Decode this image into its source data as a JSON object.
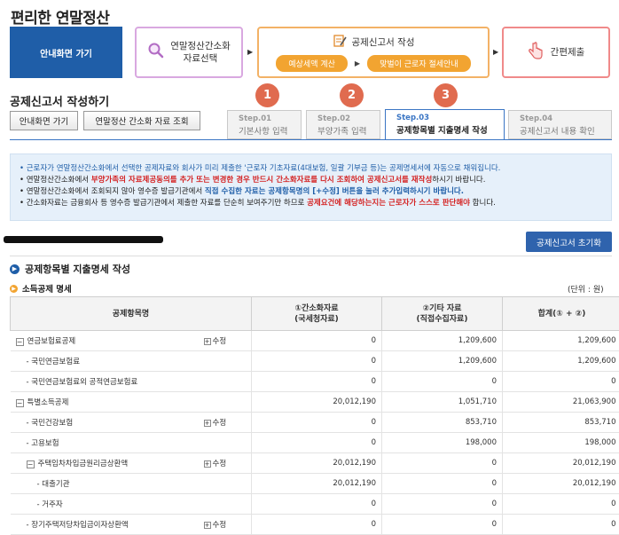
{
  "app_title": "편리한 연말정산",
  "guide_box_label": "안내화면 가기",
  "flow": {
    "step1": [
      "연말정산간소화",
      "자료선택"
    ],
    "step2": {
      "title": "공제신고서 작성",
      "pill1": "예상세액 계산",
      "pill2": "맞벌이 근로자 절세안내"
    },
    "step3": "간편제출"
  },
  "section_title": "공제신고서 작성하기",
  "buttons": {
    "guide": "안내화면 가기",
    "lookup": "연말정산 간소화 자료 조회",
    "reset": "공제신고서 초기화"
  },
  "steps": [
    {
      "badge": "1",
      "num": "Step.01",
      "label": "기본사항 입력"
    },
    {
      "badge": "2",
      "num": "Step.02",
      "label": "부양가족 입력"
    },
    {
      "badge": "3",
      "num": "Step.03",
      "label": "공제항목별 지출명세 작성"
    },
    {
      "num": "Step.04",
      "label": "공제신고서 내용 확인"
    }
  ],
  "notices": {
    "n1": "근로자가 연말정산간소화에서 선택한 공제자료와 회사가 미리 제출한 '근로자 기초자료(4대보험, 일괄 기부금 등)는 공제명세서에 자동으로 채워집니다.",
    "n2_a": "연말정산간소화에서 ",
    "n2_b": "부양가족의 자료제공동의를 추가 또는 변경한 경우 반드시 간소화자료를 다시 조회하여 공제신고서를 재작성",
    "n2_c": "하시기 바랍니다.",
    "n3_a": "연말정산간소화에서 조회되지 않아 영수증 발급기관에서 ",
    "n3_b": "직접 수집한 자료는 공제항목명의 [+수정] 버튼을 눌러 추가입력하시기 바랍니다.",
    "n4_a": "간소화자료는 금융회사 등 영수증 발급기관에서 제출한 자료를 단순히 보여주기만 하므로 ",
    "n4_b": "공제요건에 해당하는지는 근로자가 스스로 판단해야",
    "n4_c": " 합니다."
  },
  "sub_title": "공제항목별 지출명세 작성",
  "sub_sub_title": "소득공제 명세",
  "unit": "(단위 : 원)",
  "table": {
    "headers": {
      "item": "공제항목명",
      "col1_a": "①간소화자료",
      "col1_b": "(국세청자료)",
      "col2_a": "②기타 자료",
      "col2_b": "(직접수집자료)",
      "total": "합계(① + ②)"
    },
    "edit_label": "수정",
    "rows": [
      {
        "name": "연금보험료공제",
        "toggle": "−",
        "edit": true,
        "v1": "0",
        "v2": "1,209,600",
        "total": "1,209,600"
      },
      {
        "name": "- 국민연금보험료",
        "v1": "0",
        "v2": "1,209,600",
        "total": "1,209,600"
      },
      {
        "name": "- 국민연금보험료외 공적연금보험료",
        "v1": "0",
        "v2": "0",
        "total": "0"
      },
      {
        "name": "특별소득공제",
        "toggle": "−",
        "v1": "20,012,190",
        "v2": "1,051,710",
        "total": "21,063,900"
      },
      {
        "name": "- 국민건강보험",
        "edit": true,
        "v1": "0",
        "v2": "853,710",
        "total": "853,710"
      },
      {
        "name": "- 고용보험",
        "v1": "0",
        "v2": "198,000",
        "total": "198,000"
      },
      {
        "name": "주택임차차입금원리금상환액",
        "toggle": "−",
        "edit": true,
        "v1": "20,012,190",
        "v2": "0",
        "total": "20,012,190"
      },
      {
        "name": "- 대출기관",
        "v1": "20,012,190",
        "v2": "0",
        "total": "20,012,190"
      },
      {
        "name": "- 거주자",
        "v1": "0",
        "v2": "0",
        "total": "0"
      },
      {
        "name": "- 장기주택저당차입금이자상환액",
        "edit": true,
        "v1": "0",
        "v2": "0",
        "total": "0"
      }
    ]
  },
  "colors": {
    "primary_blue": "#1f5ea8",
    "orange": "#f2a431",
    "badge_red": "#e06b4f",
    "notice_red": "#d42222"
  }
}
